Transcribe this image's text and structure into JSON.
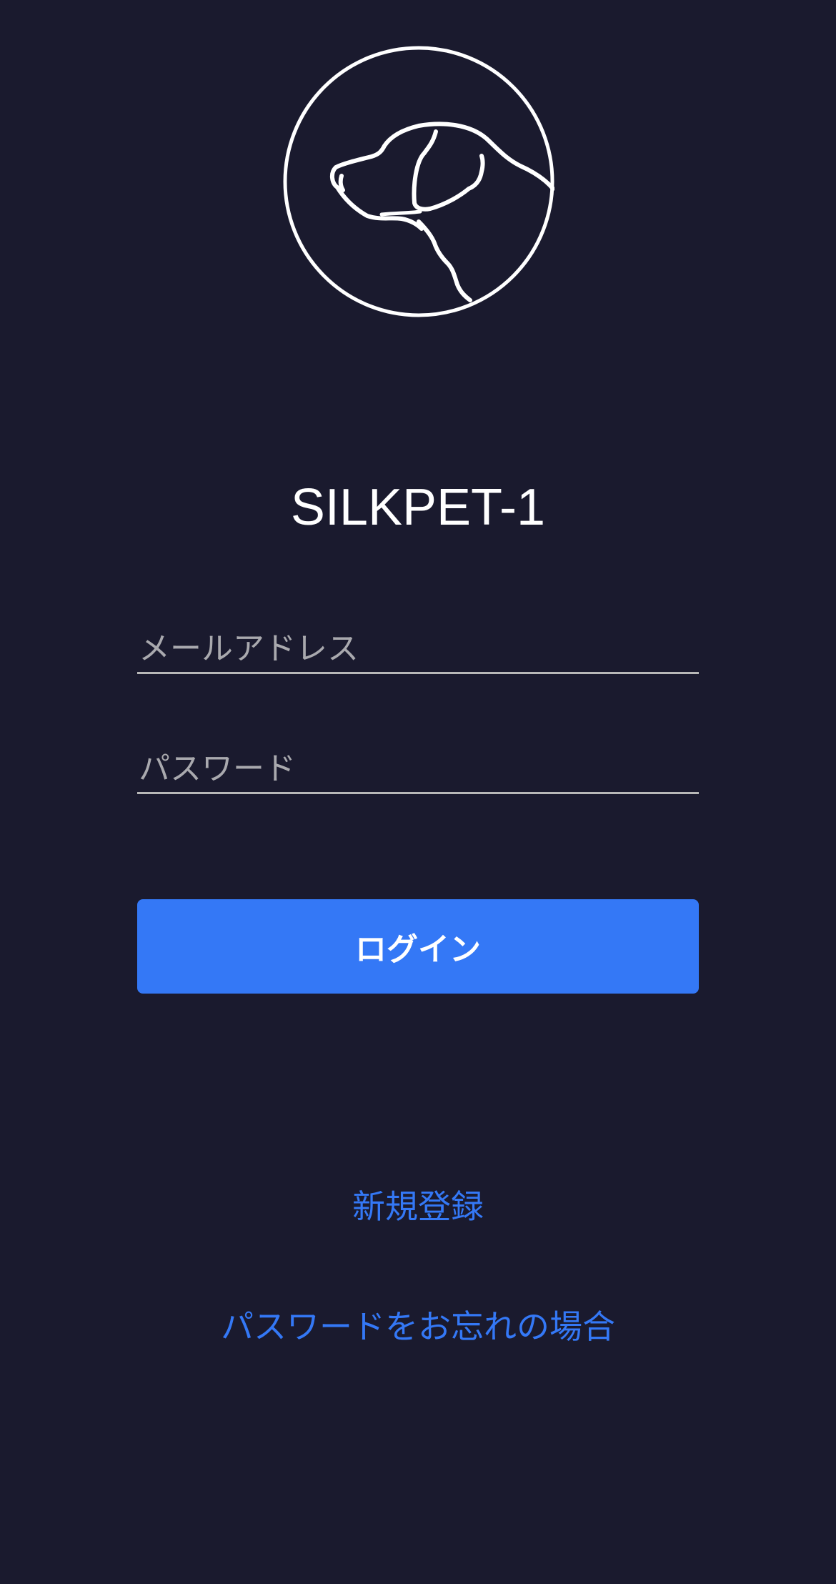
{
  "logo": {
    "icon": "dog-head-icon"
  },
  "app": {
    "title": "SILKPET-1"
  },
  "form": {
    "email": {
      "placeholder": "メールアドレス",
      "value": ""
    },
    "password": {
      "placeholder": "パスワード",
      "value": ""
    },
    "login_label": "ログイン"
  },
  "links": {
    "register": "新規登録",
    "forgot_password": "パスワードをお忘れの場合"
  },
  "colors": {
    "background": "#1a1a2e",
    "accent": "#3478f6",
    "text": "#ffffff",
    "underline": "#b8b8b8"
  }
}
